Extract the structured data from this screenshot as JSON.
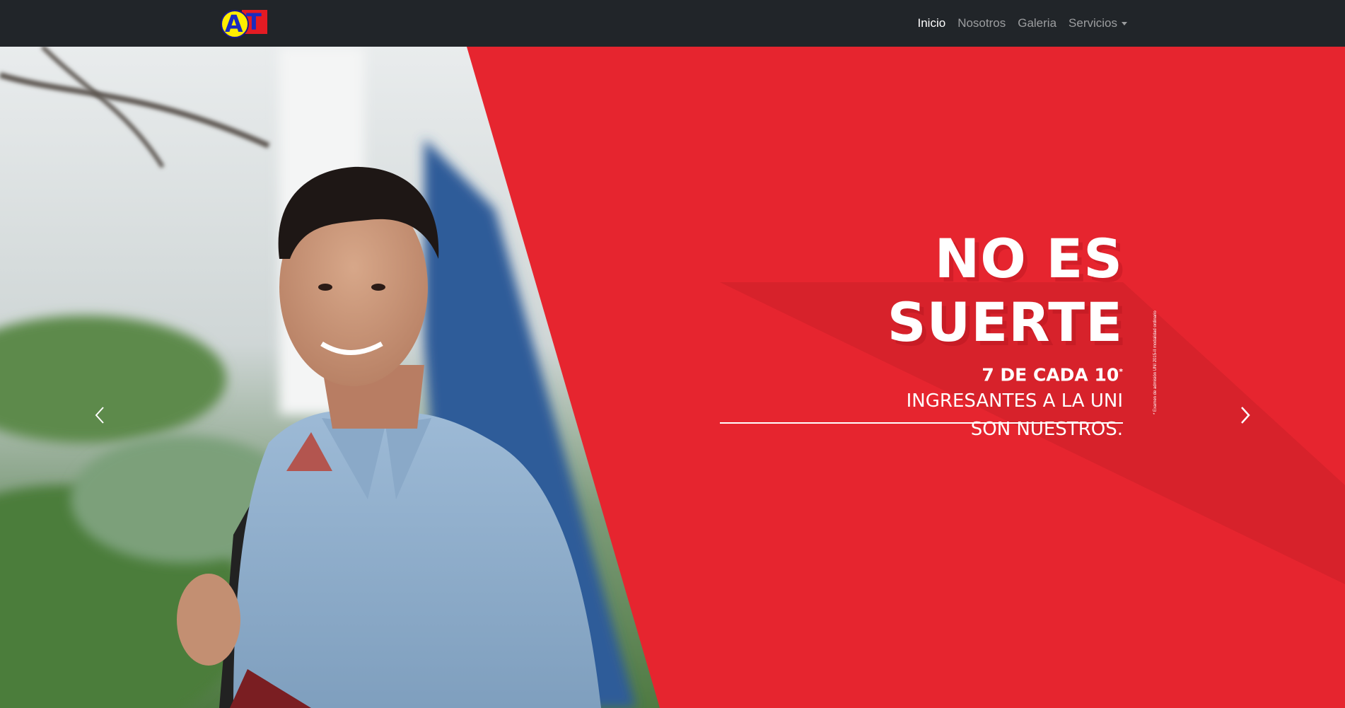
{
  "navbar": {
    "brand": {
      "letter_a": "A",
      "letter_t": "T"
    },
    "links": [
      {
        "label": "Inicio",
        "active": true
      },
      {
        "label": "Nosotros",
        "active": false
      },
      {
        "label": "Galeria",
        "active": false
      },
      {
        "label": "Servicios",
        "active": false,
        "dropdown": true
      }
    ]
  },
  "hero": {
    "headline": "NO ES SUERTE",
    "stat": "7 DE CADA 10",
    "stat_mark": "*",
    "line1": "INGRESANTES A LA UNI",
    "line2": "SON NUESTROS.",
    "footnote": "* Examen de admisión UNI 2015-II modalidad ordinario",
    "prev_icon": "chevron-left-icon",
    "next_icon": "chevron-right-icon"
  },
  "carousel": {
    "slide_count": 3,
    "active_index": 2
  },
  "colors": {
    "navbar_bg": "#212529",
    "hero_red": "#e6252f",
    "brand_yellow": "#ffed00",
    "brand_blue": "#1a2bbf"
  }
}
